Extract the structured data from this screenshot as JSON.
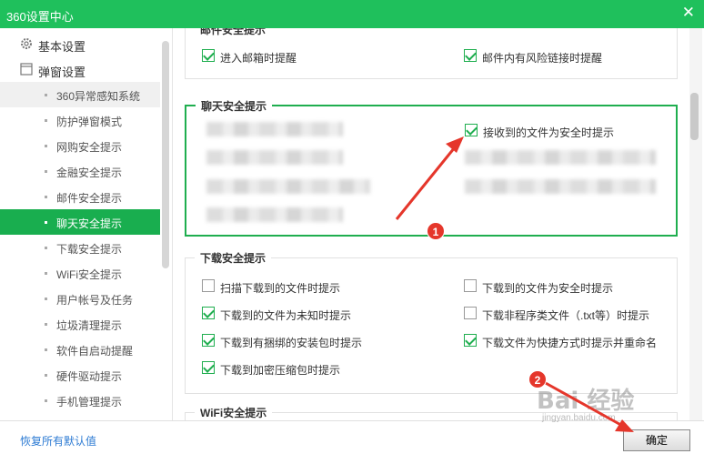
{
  "window": {
    "title": "360设置中心",
    "close_glyph": "✕"
  },
  "sidebar": {
    "groups": [
      {
        "label": "基本设置",
        "icon": "gear-icon"
      },
      {
        "label": "弹窗设置",
        "icon": "window-icon"
      }
    ],
    "items": [
      "360异常感知系统",
      "防护弹窗模式",
      "网购安全提示",
      "金融安全提示",
      "邮件安全提示",
      "聊天安全提示",
      "下载安全提示",
      "WiFi安全提示",
      "用户帐号及任务",
      "垃圾清理提示",
      "软件自启动提醒",
      "硬件驱动提示",
      "手机管理提示"
    ],
    "active_item": "聊天安全提示"
  },
  "mail_section": {
    "title": "邮件安全提示",
    "options": [
      {
        "label": "进入邮箱时提醒",
        "checked": true
      },
      {
        "label": "邮件内有风险链接时提醒",
        "checked": true
      }
    ]
  },
  "chat_section": {
    "title": "聊天安全提示",
    "options": [
      {
        "label": "接收到的文件为安全时提示",
        "checked": true
      }
    ]
  },
  "download_section": {
    "title": "下载安全提示",
    "options": [
      {
        "label": "扫描下载到的文件时提示",
        "checked": false
      },
      {
        "label": "下载到的文件为安全时提示",
        "checked": false
      },
      {
        "label": "下载到的文件为未知时提示",
        "checked": true
      },
      {
        "label": "下载非程序类文件（.txt等）时提示",
        "checked": false
      },
      {
        "label": "下载到有捆绑的安装包时提示",
        "checked": true
      },
      {
        "label": "下载文件为快捷方式时提示并重命名",
        "checked": true
      },
      {
        "label": "下载到加密压缩包时提示",
        "checked": true
      }
    ]
  },
  "wifi_section": {
    "title": "WiFi安全提示"
  },
  "footer": {
    "restore_label": "恢复所有默认值",
    "ok_label": "确定"
  },
  "annotations": {
    "badge_1": "1",
    "badge_2": "2"
  },
  "watermark": {
    "logo": "Bai 经验",
    "url": "jingyan.baidu.com"
  },
  "colors": {
    "accent": "#1fc05c",
    "active": "#19ae4f",
    "arrow": "#e5362b",
    "link": "#2d7bd3"
  }
}
